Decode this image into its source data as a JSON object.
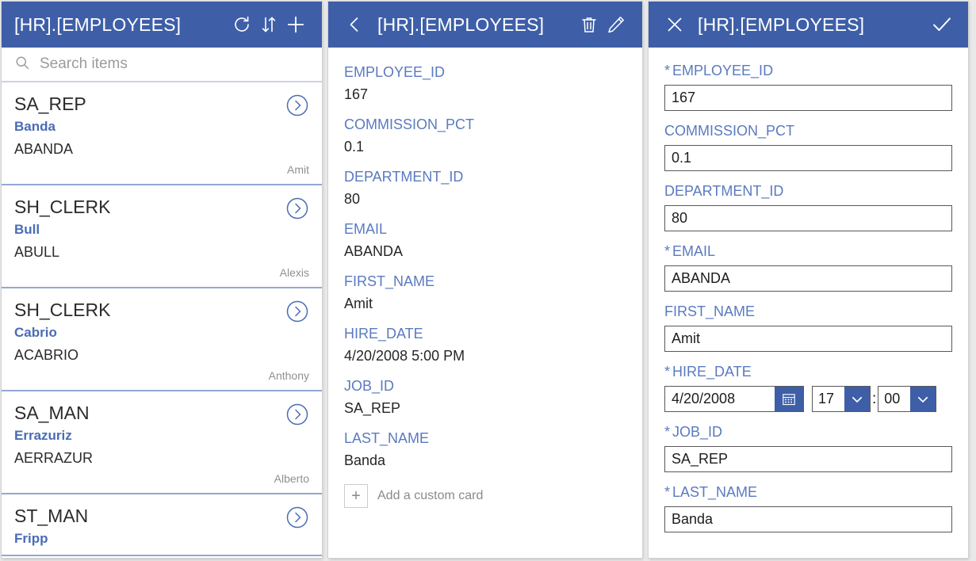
{
  "list_panel": {
    "header": {
      "title": "[HR].[EMPLOYEES]",
      "refresh_icon": "refresh-icon",
      "sort_icon": "sort-icon",
      "add_icon": "plus-icon"
    },
    "search": {
      "placeholder": "Search items",
      "value": "",
      "icon": "search-icon"
    },
    "items": [
      {
        "job": "SA_REP",
        "last_name": "Banda",
        "email": "ABANDA",
        "first_name": "Amit"
      },
      {
        "job": "SH_CLERK",
        "last_name": "Bull",
        "email": "ABULL",
        "first_name": "Alexis"
      },
      {
        "job": "SH_CLERK",
        "last_name": "Cabrio",
        "email": "ACABRIO",
        "first_name": "Anthony"
      },
      {
        "job": "SA_MAN",
        "last_name": "Errazuriz",
        "email": "AERRAZUR",
        "first_name": "Alberto"
      },
      {
        "job": "ST_MAN",
        "last_name": "Fripp",
        "email": "",
        "first_name": ""
      }
    ],
    "chevron_icon": "chevron-right-circle-icon"
  },
  "detail_panel": {
    "header": {
      "back_icon": "chevron-left-icon",
      "title": "[HR].[EMPLOYEES]",
      "delete_icon": "trash-icon",
      "edit_icon": "pencil-icon"
    },
    "fields": [
      {
        "label": "EMPLOYEE_ID",
        "value": "167"
      },
      {
        "label": "COMMISSION_PCT",
        "value": "0.1"
      },
      {
        "label": "DEPARTMENT_ID",
        "value": "80"
      },
      {
        "label": "EMAIL",
        "value": "ABANDA"
      },
      {
        "label": "FIRST_NAME",
        "value": "Amit"
      },
      {
        "label": "HIRE_DATE",
        "value": "4/20/2008 5:00 PM"
      },
      {
        "label": "JOB_ID",
        "value": "SA_REP"
      },
      {
        "label": "LAST_NAME",
        "value": "Banda"
      }
    ],
    "add_custom_card": {
      "label": "Add a custom card",
      "icon": "plus-icon"
    }
  },
  "edit_panel": {
    "header": {
      "close_icon": "close-icon",
      "title": "[HR].[EMPLOYEES]",
      "confirm_icon": "check-icon"
    },
    "fields": [
      {
        "label": "EMPLOYEE_ID",
        "value": "167",
        "required": true
      },
      {
        "label": "COMMISSION_PCT",
        "value": "0.1",
        "required": false
      },
      {
        "label": "DEPARTMENT_ID",
        "value": "80",
        "required": false
      },
      {
        "label": "EMAIL",
        "value": "ABANDA",
        "required": true
      },
      {
        "label": "FIRST_NAME",
        "value": "Amit",
        "required": false
      }
    ],
    "hire_date": {
      "label": "HIRE_DATE",
      "required": true,
      "date_value": "4/20/2008",
      "hour_value": "17",
      "minute_value": "00",
      "separator": ":",
      "calendar_icon": "calendar-icon",
      "dropdown_icon": "chevron-down-icon"
    },
    "trailing_fields": [
      {
        "label": "JOB_ID",
        "value": "SA_REP",
        "required": true
      },
      {
        "label": "LAST_NAME",
        "value": "Banda",
        "required": true
      }
    ],
    "required_marker": "*"
  },
  "theme": {
    "header_blue": "#3e5fa8",
    "label_blue": "#5a7ac0",
    "link_blue": "#4a6cb5",
    "divider_blue": "#93a8d2",
    "muted_gray": "#909090",
    "page_bg": "#e9e9e9"
  }
}
